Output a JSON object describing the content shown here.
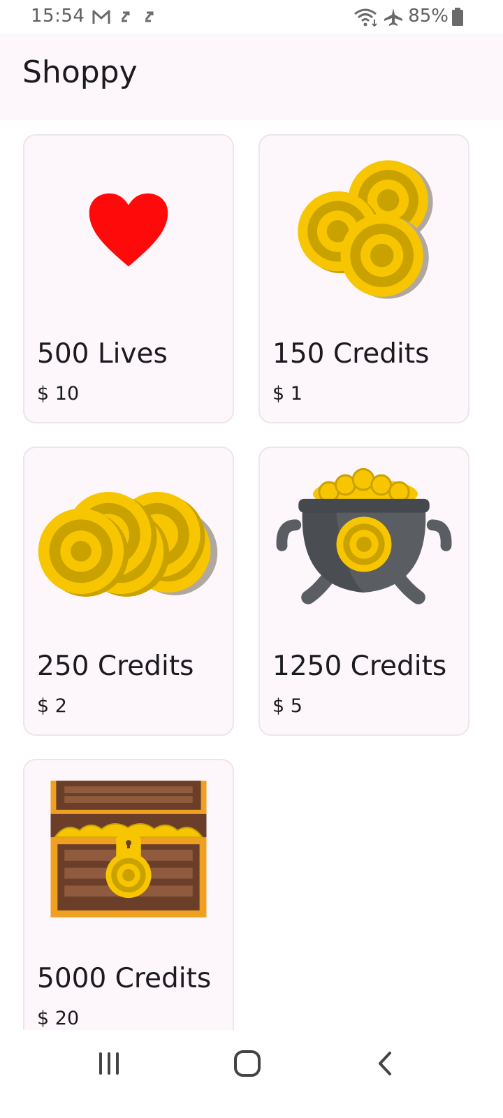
{
  "status_bar": {
    "time": "15:54",
    "battery": "85%",
    "left_icons": [
      "gmail-icon",
      "sync-icon",
      "sync-icon"
    ],
    "right_icons": [
      "wifi-icon",
      "airplane-mode-icon",
      "battery-icon"
    ]
  },
  "app_bar": {
    "title": "Shoppy"
  },
  "products": [
    {
      "title": "500 Lives",
      "price": "$ 10",
      "icon": "heart-icon"
    },
    {
      "title": "150 Credits",
      "price": "$ 1",
      "icon": "coin-stack-small-icon"
    },
    {
      "title": "250 Credits",
      "price": "$ 2",
      "icon": "coin-stack-large-icon"
    },
    {
      "title": "1250 Credits",
      "price": "$ 5",
      "icon": "coin-pot-icon"
    },
    {
      "title": "5000 Credits",
      "price": "$ 20",
      "icon": "treasure-chest-icon"
    }
  ],
  "nav_bar": {
    "icons": [
      "recent-apps-icon",
      "home-icon",
      "back-icon"
    ]
  },
  "colors": {
    "background": "#ffffff",
    "app_bar": "#fdf7fc",
    "card": "#fdf7fc",
    "card_border": "#ece5ec",
    "heart": "#ff0a0a",
    "coin": "#f7c600",
    "coin_dark": "#c9a200"
  }
}
